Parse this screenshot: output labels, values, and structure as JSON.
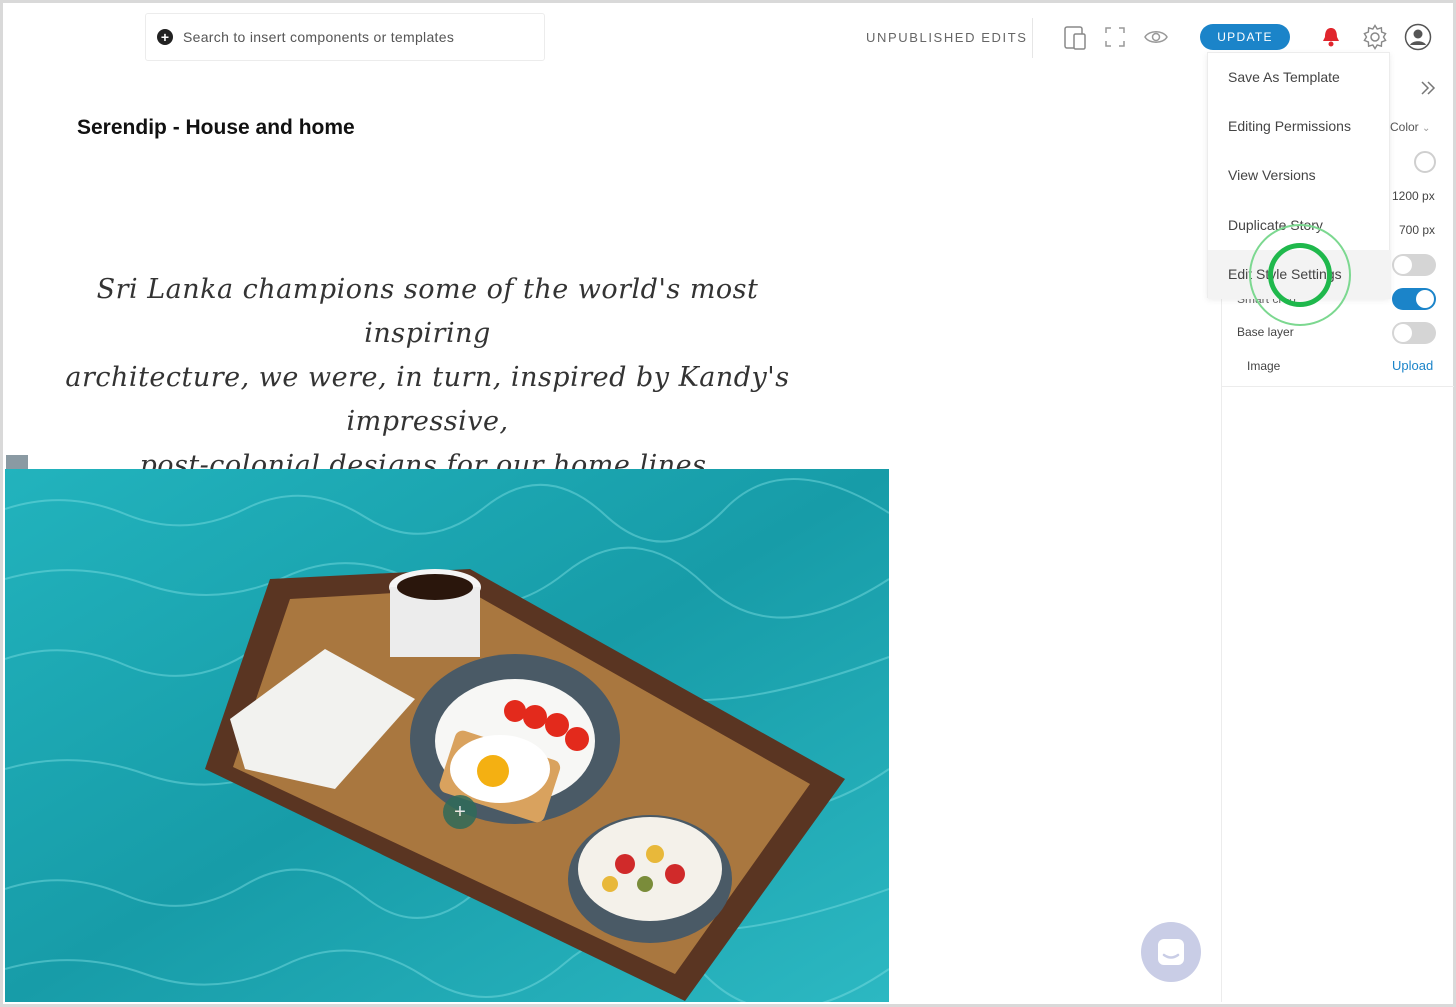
{
  "toolbar": {
    "search_placeholder": "Search to insert components or templates",
    "status": "UNPUBLISHED EDITS",
    "update_label": "UPDATE",
    "icons": [
      "mobile-preview-icon",
      "fullscreen-icon",
      "eye-icon",
      "bell-icon",
      "gear-icon",
      "user-avatar-icon"
    ]
  },
  "page": {
    "title": "Serendip - House and home",
    "quote_lines": [
      "Sri Lanka champions some of the world's most inspiring",
      "architecture, we were, in turn, inspired by Kandy's impressive,",
      "post-colonial designs for our home lines."
    ]
  },
  "settings_menu": {
    "items": [
      {
        "label": "Save As Template"
      },
      {
        "label": "Editing Permissions"
      },
      {
        "label": "View Versions"
      },
      {
        "label": "Duplicate Story"
      },
      {
        "label": "Edit Style Settings"
      }
    ]
  },
  "right_panel": {
    "color_label": "Color",
    "width_value": "1200 px",
    "height_value": "700 px",
    "smart_label": "Smart crop",
    "base_layer_label": "Base layer",
    "image_label": "Image",
    "upload_label": "Upload",
    "toggles": {
      "first": false,
      "smart": true,
      "base_layer": false
    }
  },
  "colors": {
    "accent": "#1b84c9",
    "bell": "#e0262d",
    "click_indicator": "#1fb84c",
    "pool": "#1aa6b0"
  }
}
